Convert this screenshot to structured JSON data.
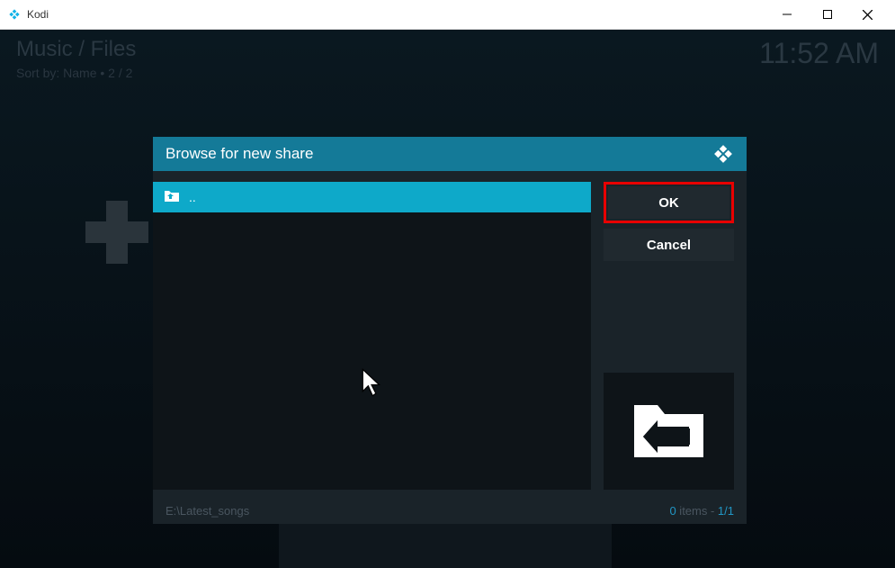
{
  "window": {
    "title": "Kodi"
  },
  "header": {
    "breadcrumb": "Music / Files",
    "sort": "Sort by: Name  •  2 / 2",
    "time": "11:52 AM"
  },
  "dialog": {
    "title": "Browse for new share",
    "list": {
      "items": [
        {
          "label": ".."
        }
      ]
    },
    "buttons": {
      "ok": "OK",
      "cancel": "Cancel"
    },
    "footer": {
      "path": "E:\\Latest_songs",
      "count_num": "0",
      "count_items": " items - ",
      "count_page": "1/1"
    }
  }
}
